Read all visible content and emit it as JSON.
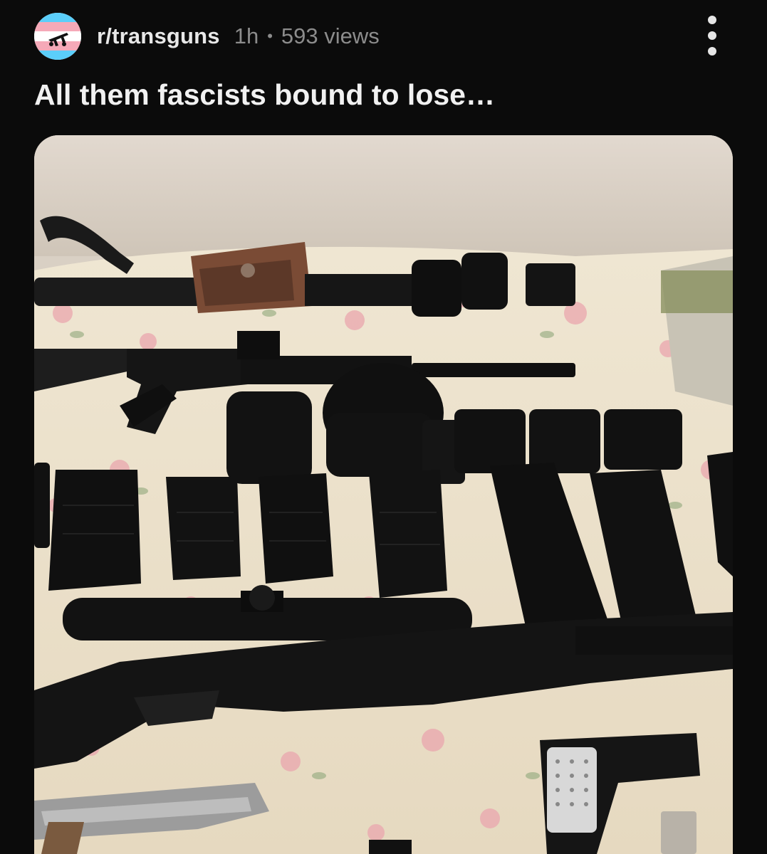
{
  "post": {
    "subreddit": "r/transguns",
    "age": "1h",
    "separator": "•",
    "views": "593 views",
    "title": "All them fascists bound to lose…"
  },
  "icons": {
    "avatar": "subreddit-avatar",
    "menu": "more-vertical-icon"
  },
  "colors": {
    "background": "#0b0b0b",
    "text_primary": "#f1f1f1",
    "text_secondary": "#8c8c8c",
    "flag_blue": "#5bcefa",
    "flag_pink": "#f5a9b8",
    "flag_white": "#ffffff"
  }
}
